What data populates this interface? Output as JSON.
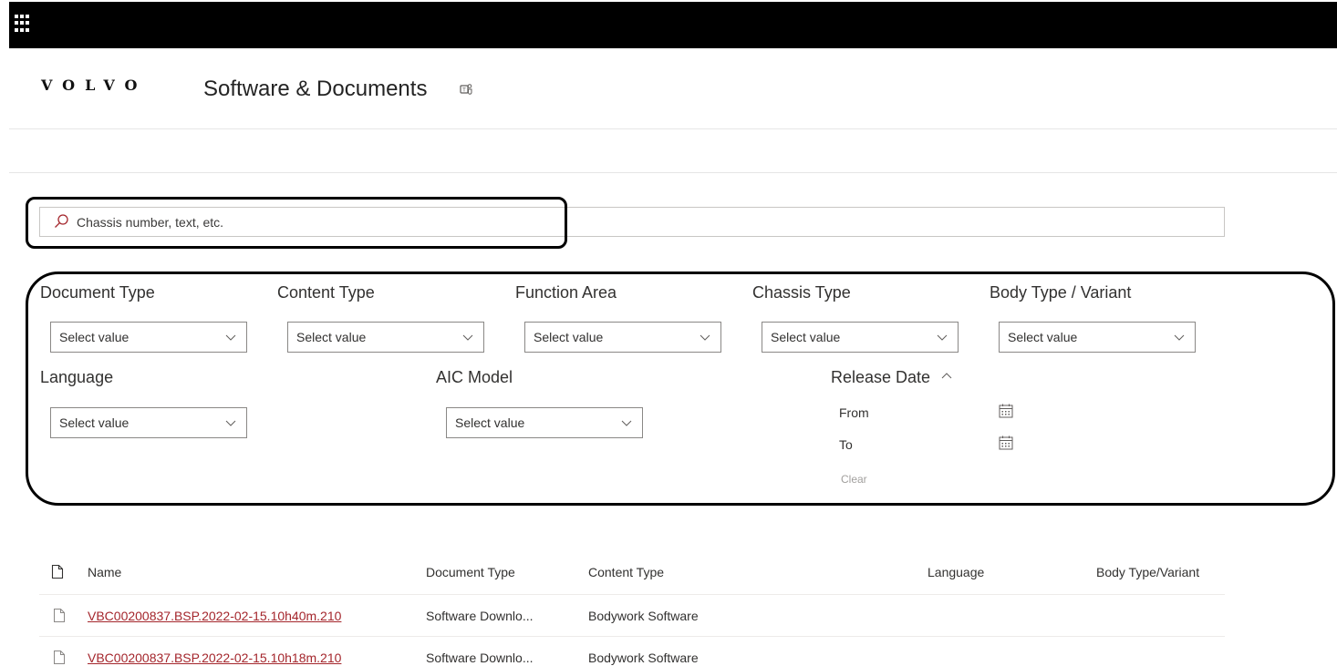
{
  "header": {
    "brand_logo": "VOLVO",
    "site_title": "Software & Documents",
    "icons": {
      "app_launcher": "waffle-icon",
      "teams": "teams-icon"
    }
  },
  "search": {
    "placeholder": "Chassis number, text, etc.",
    "value": "",
    "icon": "search-icon"
  },
  "filters": {
    "document_type": {
      "label": "Document Type",
      "value": "Select value"
    },
    "content_type": {
      "label": "Content Type",
      "value": "Select value"
    },
    "function_area": {
      "label": "Function Area",
      "value": "Select value"
    },
    "chassis_type": {
      "label": "Chassis Type",
      "value": "Select value"
    },
    "body_type": {
      "label": "Body Type / Variant",
      "value": "Select value"
    },
    "language": {
      "label": "Language",
      "value": "Select value"
    },
    "aic_model": {
      "label": "AIC Model",
      "value": "Select value"
    },
    "release_date": {
      "label": "Release Date",
      "expanded": true,
      "from_label": "From",
      "to_label": "To",
      "clear_label": "Clear"
    }
  },
  "table": {
    "columns": [
      "Name",
      "Document Type",
      "Content Type",
      "Language",
      "Body Type/Variant"
    ],
    "rows": [
      {
        "name": "VBC00200837.BSP.2022-02-15.10h40m.210",
        "document_type": "Software Downlo...",
        "content_type": "Bodywork Software",
        "language": "",
        "body_type": ""
      },
      {
        "name": "VBC00200837.BSP.2022-02-15.10h18m.210",
        "document_type": "Software Downlo...",
        "content_type": "Bodywork Software",
        "language": "",
        "body_type": ""
      }
    ]
  },
  "colors": {
    "topbar": "#000000",
    "link": "#a4262c",
    "border": "#8a8886",
    "highlight": "#000000"
  }
}
